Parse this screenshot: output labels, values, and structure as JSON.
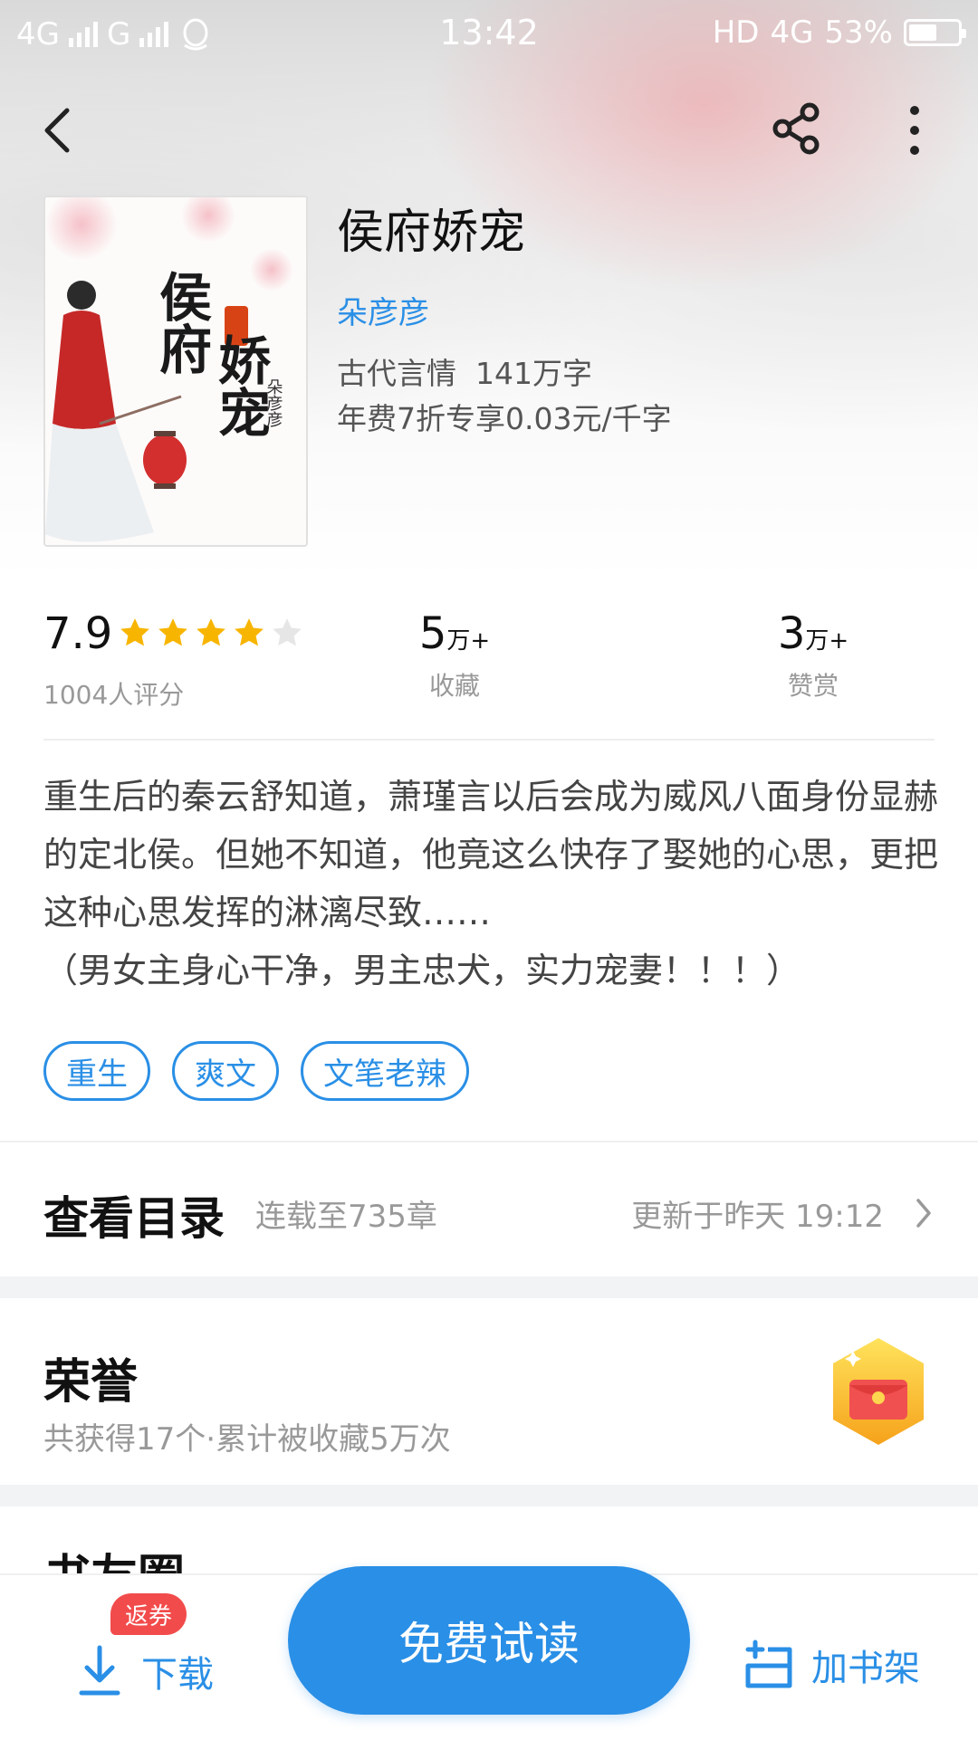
{
  "status_bar": {
    "left_net1": "4G",
    "left_net2": "G",
    "time": "13:42",
    "hd": "HD",
    "right_net": "4G",
    "battery": "53%"
  },
  "book": {
    "title": "侯府娇宠",
    "author": "朵彦彦",
    "category_words": "古代言情  141万字",
    "price_note": "年费7折专享0.03元/千字",
    "cover_title_line1": "侯府",
    "cover_title_line2": "娇宠",
    "cover_author": "朵彦彦"
  },
  "stats": {
    "rating": "7.9",
    "rating_stars": 4,
    "rating_count": "1004人评分",
    "favorites_num": "5",
    "favorites_unit": "万+",
    "favorites_label": "收藏",
    "rewards_num": "3",
    "rewards_unit": "万+",
    "rewards_label": "赞赏"
  },
  "intro": {
    "line1": "重生后的秦云舒知道，萧瑾言以后会成为威风八面身份显赫的定北侯。但她不知道，他竟这么快存了娶她的心思，更把这种心思发挥的淋漓尽致……",
    "line2": "（男女主身心干净，男主忠犬，实力宠妻！！！）"
  },
  "tags": [
    "重生",
    "爽文",
    "文笔老辣"
  ],
  "toc": {
    "title": "查看目录",
    "progress": "连载至735章",
    "updated": "更新于昨天 19:12"
  },
  "honor": {
    "title": "荣誉",
    "summary": "共获得17个·累计被收藏5万次"
  },
  "next_section_title": "书友圈",
  "bottom": {
    "coupon": "返券",
    "download": "下载",
    "read": "免费试读",
    "shelf": "加书架"
  },
  "colors": {
    "accent": "#2a8fe6",
    "coupon_red": "#f24b4b",
    "star": "#f7b500"
  }
}
